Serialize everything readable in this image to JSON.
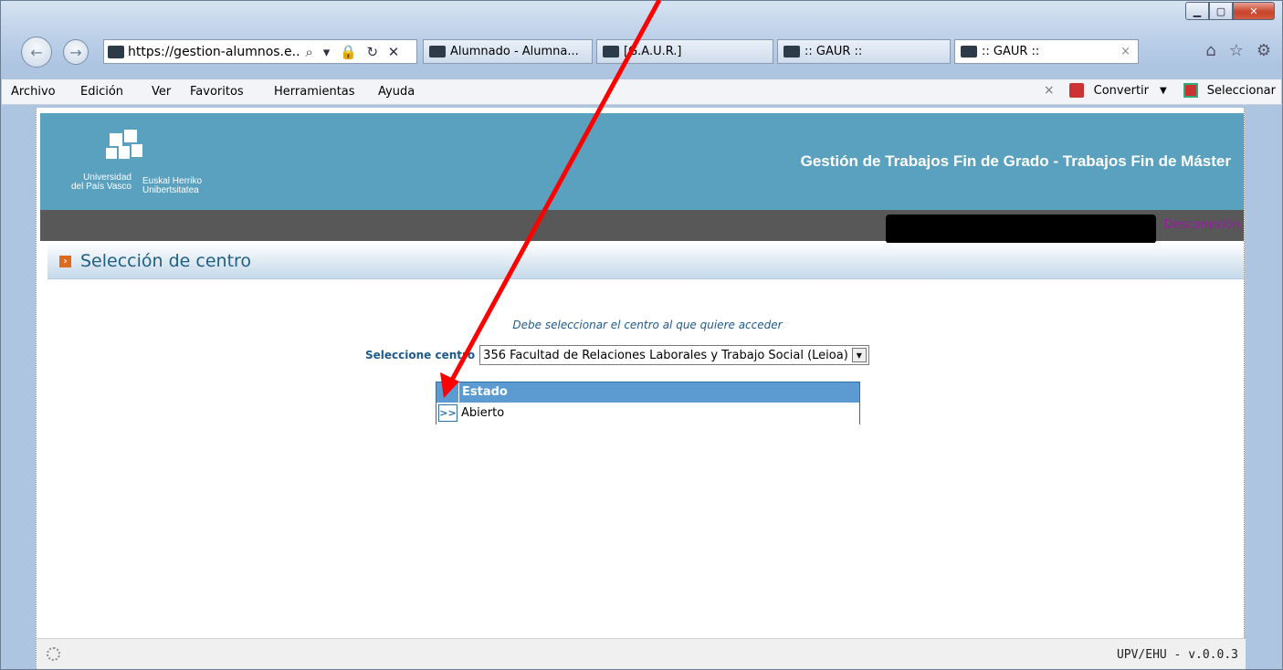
{
  "browser": {
    "address": {
      "url_bold": "https://gestion-alumnos.e..",
      "url_host": "gestion-alumnos.e.."
    },
    "tabs": [
      {
        "label": "Alumnado - Alumna..."
      },
      {
        "label": "[G.A.U.R.]"
      },
      {
        "label": ":: GAUR ::"
      },
      {
        "label": ":: GAUR ::"
      }
    ],
    "tab_close": "×",
    "menu": [
      "Archivo",
      "Edición",
      "Ver",
      "Favoritos",
      "Herramientas",
      "Ayuda"
    ],
    "menu_right": {
      "close": "×",
      "convert": "Convertir",
      "select": "Seleccionar"
    }
  },
  "site": {
    "logo": {
      "left_line1": "Universidad",
      "left_line2": "del País Vasco",
      "right_line1": "Euskal Herriko",
      "right_line2": "Unibertsitatea"
    },
    "title": "Gestión de Trabajos Fin de Grado - Trabajos Fin de Máster",
    "logout": "Desconexión"
  },
  "section": {
    "title": "Selección de centro"
  },
  "form": {
    "notice": "Debe seleccionar el centro al que quiere acceder",
    "centro_label": "Seleccione centro",
    "centro_value": "356 Facultad de Relaciones Laborales y Trabajo Social (Leioa)"
  },
  "grid": {
    "column": "Estado",
    "rows": [
      {
        "go": ">>",
        "estado": "Abierto"
      }
    ]
  },
  "footer": {
    "version": "UPV/EHU - v.0.0.3"
  },
  "colors": {
    "header": "#5aa0bf",
    "annotation": "#ff0000"
  }
}
